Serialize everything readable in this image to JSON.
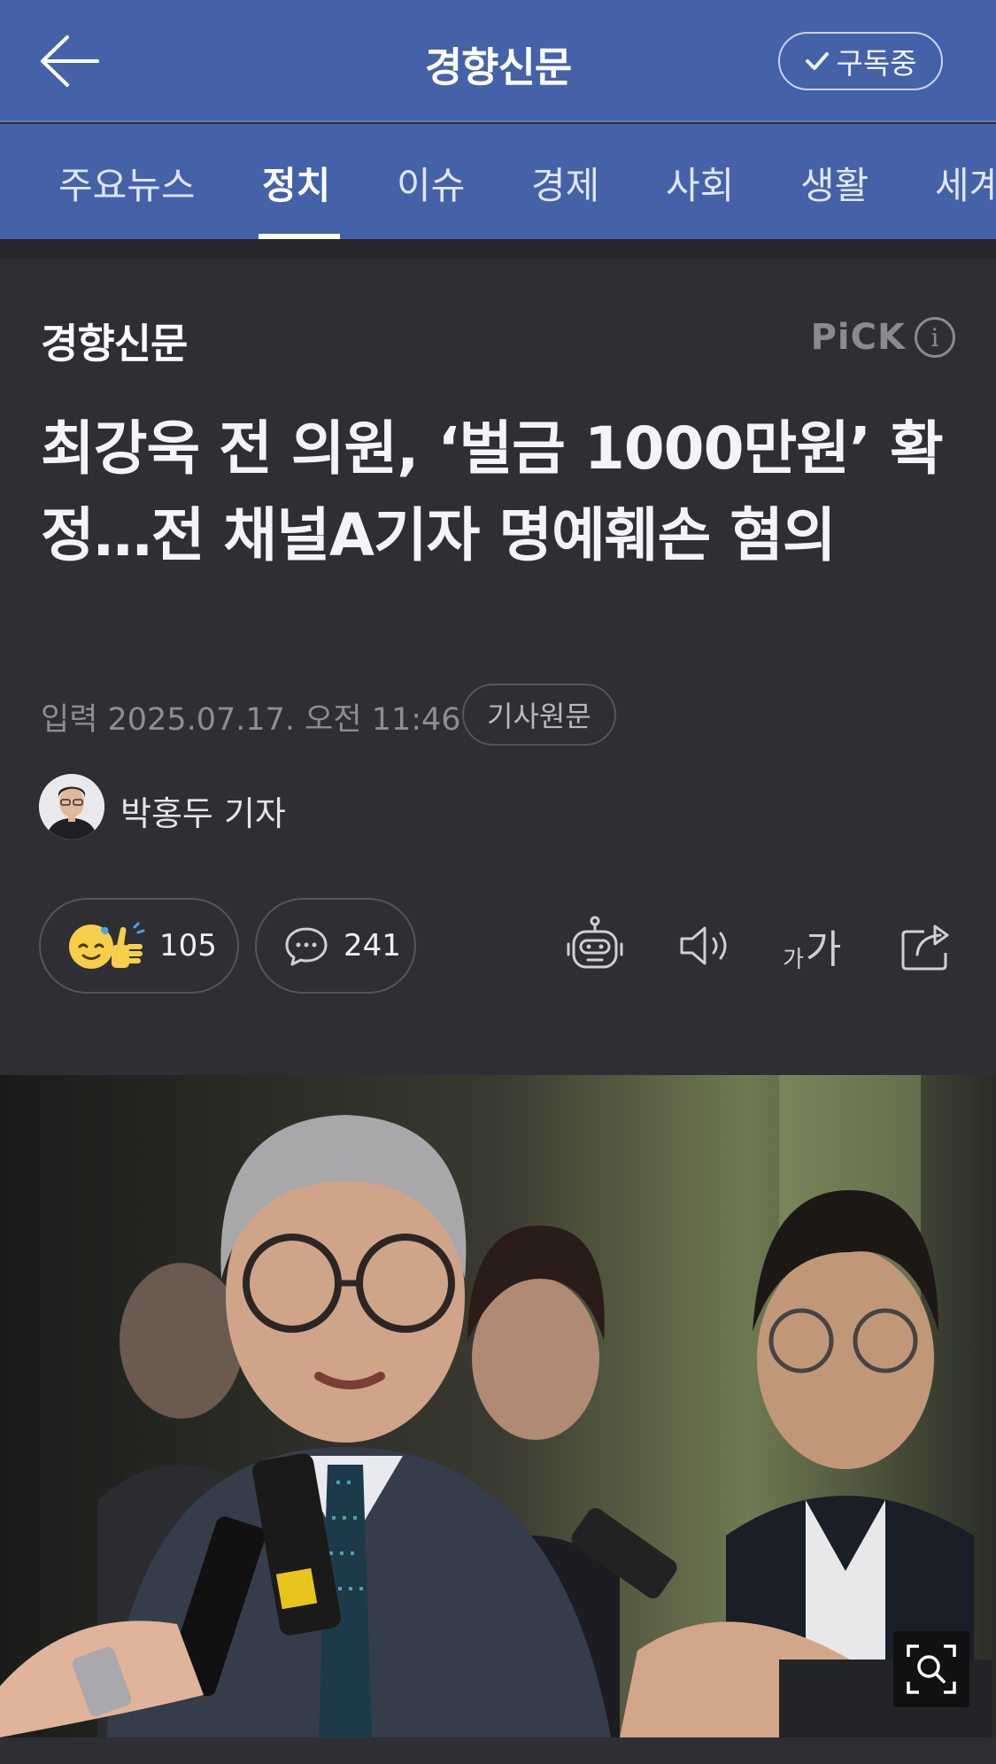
{
  "header": {
    "back_icon": "arrow-left-icon",
    "title": "경향신문",
    "subscribe_label": "구독중",
    "subscribe_icon": "check-icon"
  },
  "tabs": [
    {
      "label": "주요뉴스",
      "active": false
    },
    {
      "label": "정치",
      "active": true
    },
    {
      "label": "이슈",
      "active": false
    },
    {
      "label": "경제",
      "active": false
    },
    {
      "label": "사회",
      "active": false
    },
    {
      "label": "생활",
      "active": false
    },
    {
      "label": "세계",
      "active": false
    }
  ],
  "article": {
    "press": "경향신문",
    "pick_label": "PiCK",
    "pick_info_icon": "info-icon",
    "headline": "최강욱 전 의원, ‘벌금 1000만원’ 확정…전 채널A기자 명예훼손 혐의",
    "date": "입력 2025.07.17. 오전 11:46",
    "origin_label": "기사원문",
    "reporter": "박홍두 기자"
  },
  "actions": {
    "reaction_count": "105",
    "comment_count": "241",
    "tools": [
      "robot-summary-icon",
      "speaker-icon",
      "font-size-icon",
      "share-icon"
    ],
    "font_size_label_small": "가",
    "font_size_label_big": "가"
  },
  "colors": {
    "header_bg": "#4562a8",
    "page_bg": "#2f2e34",
    "muted_text": "#8d8d93"
  }
}
